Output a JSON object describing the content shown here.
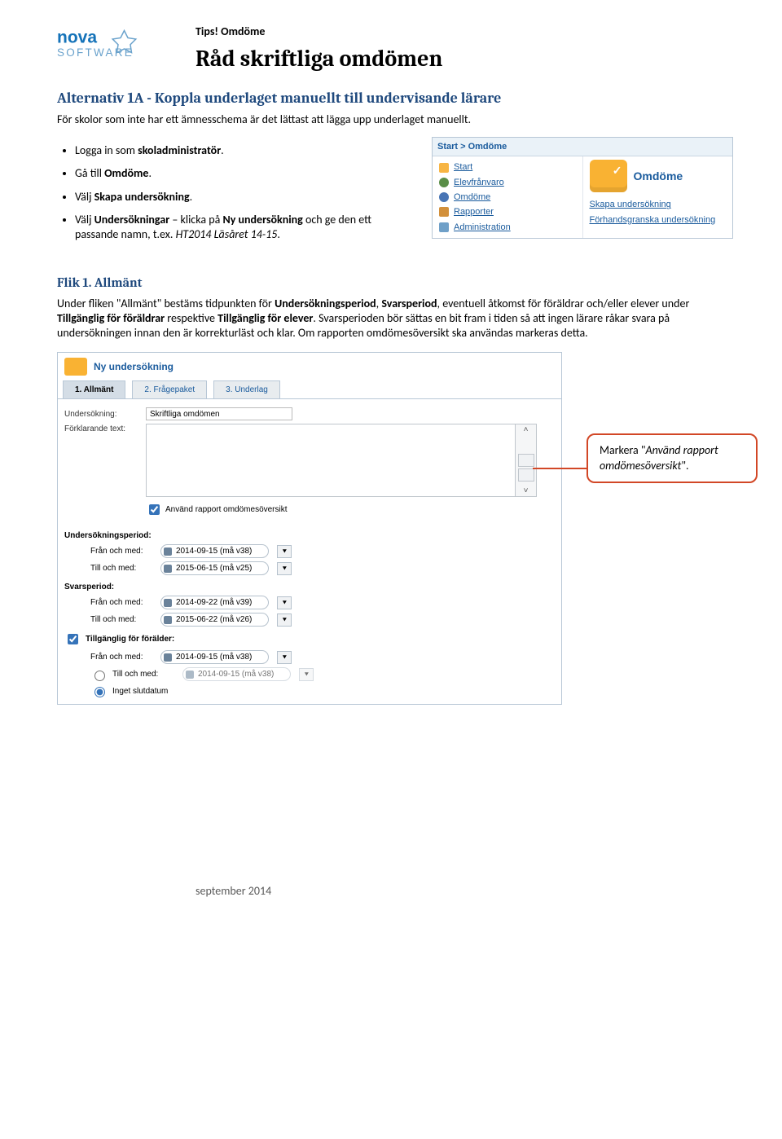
{
  "header": {
    "tips": "Tips! Omdöme",
    "title": "Råd skriftliga omdömen",
    "logo": {
      "line1": "nova",
      "line2": "SOFTWARE"
    }
  },
  "section1": {
    "heading_main": "Alternativ 1A - Koppla underlaget manuellt till undervisande lärare",
    "intro": "För skolor som inte har ett ämnesschema är det lättast att lägga upp underlaget manuellt.",
    "bullet1": {
      "pre": "Logga in som ",
      "b": "skoladministratör",
      "post": "."
    },
    "bullet2": {
      "pre": "Gå till ",
      "b": "Omdöme",
      "post": "."
    },
    "bullet3": {
      "pre": "Välj ",
      "b": "Skapa undersökning",
      "post": "."
    },
    "bullet4": {
      "pre": "Välj ",
      "b1": "Undersökningar",
      "mid1": " – klicka på ",
      "b2": "Ny undersökning",
      "mid2": " och ge den ett passande namn, t.ex. ",
      "i": "HT2014 Läsåret 14-15",
      "post": "."
    }
  },
  "menu": {
    "breadcrumb": "Start > Omdöme",
    "left": [
      {
        "label": "Start"
      },
      {
        "label": "Elevfrånvaro"
      },
      {
        "label": "Omdöme"
      },
      {
        "label": "Rapporter"
      },
      {
        "label": "Administration"
      }
    ],
    "right": {
      "big": "Omdöme",
      "links": [
        "Skapa undersökning",
        "Förhandsgranska undersökning"
      ]
    }
  },
  "flik1": {
    "heading": "Flik 1. Allmänt",
    "para": {
      "p1": "Under fliken \"Allmänt\" bestäms tidpunkten för ",
      "b1": "Undersökningsperiod",
      "p2": ", ",
      "b2": "Svarsperiod",
      "p3": ", eventuell åtkomst för föräldrar och/eller elever under ",
      "b3": "Tillgänglig för föräldrar",
      "p4": " respektive ",
      "b4": "Tillgänglig för elever",
      "p5": ". Svarsperioden bör sättas en bit fram i tiden så att ingen lärare råkar svara på undersökningen innan den är korrekturläst och klar. Om rapporten omdömesöversikt ska användas markeras detta."
    }
  },
  "form": {
    "title": "Ny undersökning",
    "tabs": {
      "t1": "1. Allmänt",
      "t2": "2. Frågepaket",
      "t3": "3. Underlag"
    },
    "row_unders": {
      "label": "Undersökning:",
      "value": "Skriftliga omdömen"
    },
    "row_text": {
      "label": "Förklarande text:"
    },
    "cb_report": "Använd rapport omdömesöversikt",
    "up": {
      "heading": "Undersökningsperiod:",
      "from": {
        "label": "Från och med:",
        "value": "2014-09-15 (må v38)"
      },
      "to": {
        "label": "Till och med:",
        "value": "2015-06-15 (må v25)"
      }
    },
    "sp": {
      "heading": "Svarsperiod:",
      "from": {
        "label": "Från och med:",
        "value": "2014-09-22 (må v39)"
      },
      "to": {
        "label": "Till och med:",
        "value": "2015-06-22 (må v26)"
      }
    },
    "tf": {
      "heading": "Tillgänglig för förälder:",
      "from": {
        "label": "Från och med:",
        "value": "2014-09-15 (må v38)"
      },
      "to": {
        "label": "Till och med:",
        "value": "2014-09-15 (må v38)"
      },
      "noend": "Inget slutdatum"
    }
  },
  "callout": {
    "pre": "Markera \"",
    "i": "Använd rapport omdömesöversikt",
    "post": "\"."
  },
  "footer": "september 2014"
}
